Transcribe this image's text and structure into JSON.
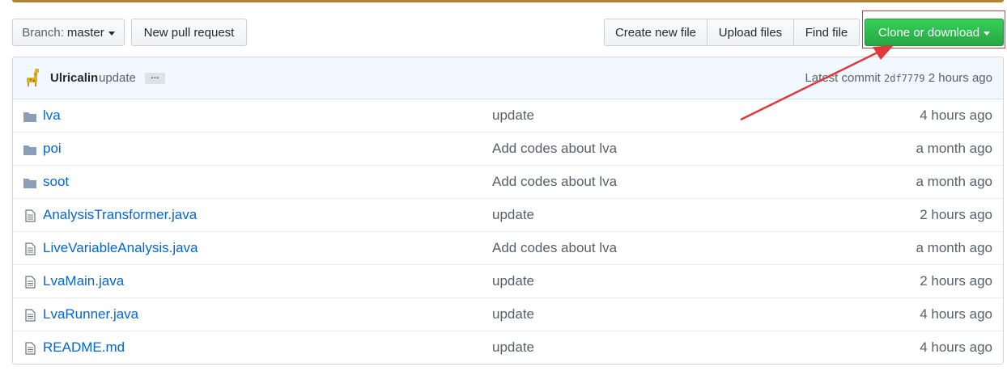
{
  "toolbar": {
    "branch_label": "Branch:",
    "branch_value": "master",
    "new_pr": "New pull request",
    "create_file": "Create new file",
    "upload_files": "Upload files",
    "find_file": "Find file",
    "clone_download": "Clone or download"
  },
  "commit": {
    "author": "Ulricalin",
    "message": "update",
    "ellipsis": "…",
    "latest_label": "Latest commit",
    "sha": "2df7779",
    "age": "2 hours ago"
  },
  "files": [
    {
      "type": "folder",
      "icon": "folder-icon",
      "name": "lva",
      "message": "update",
      "age": "4 hours ago"
    },
    {
      "type": "folder",
      "icon": "folder-icon",
      "name": "poi",
      "message": "Add codes about lva",
      "age": "a month ago"
    },
    {
      "type": "folder",
      "icon": "folder-icon",
      "name": "soot",
      "message": "Add codes about lva",
      "age": "a month ago"
    },
    {
      "type": "file",
      "icon": "file-icon",
      "name": "AnalysisTransformer.java",
      "message": "update",
      "age": "2 hours ago"
    },
    {
      "type": "file",
      "icon": "file-icon",
      "name": "LiveVariableAnalysis.java",
      "message": "Add codes about lva",
      "age": "a month ago"
    },
    {
      "type": "file",
      "icon": "file-icon",
      "name": "LvaMain.java",
      "message": "update",
      "age": "2 hours ago"
    },
    {
      "type": "file",
      "icon": "file-icon",
      "name": "LvaRunner.java",
      "message": "update",
      "age": "4 hours ago"
    },
    {
      "type": "file",
      "icon": "file-icon",
      "name": "README.md",
      "message": "update",
      "age": "4 hours ago"
    }
  ],
  "colors": {
    "accent_green": "#28a745",
    "link_blue": "#0366d6",
    "annotation_red": "#e0383d",
    "folder_gray": "#79b8ff"
  }
}
